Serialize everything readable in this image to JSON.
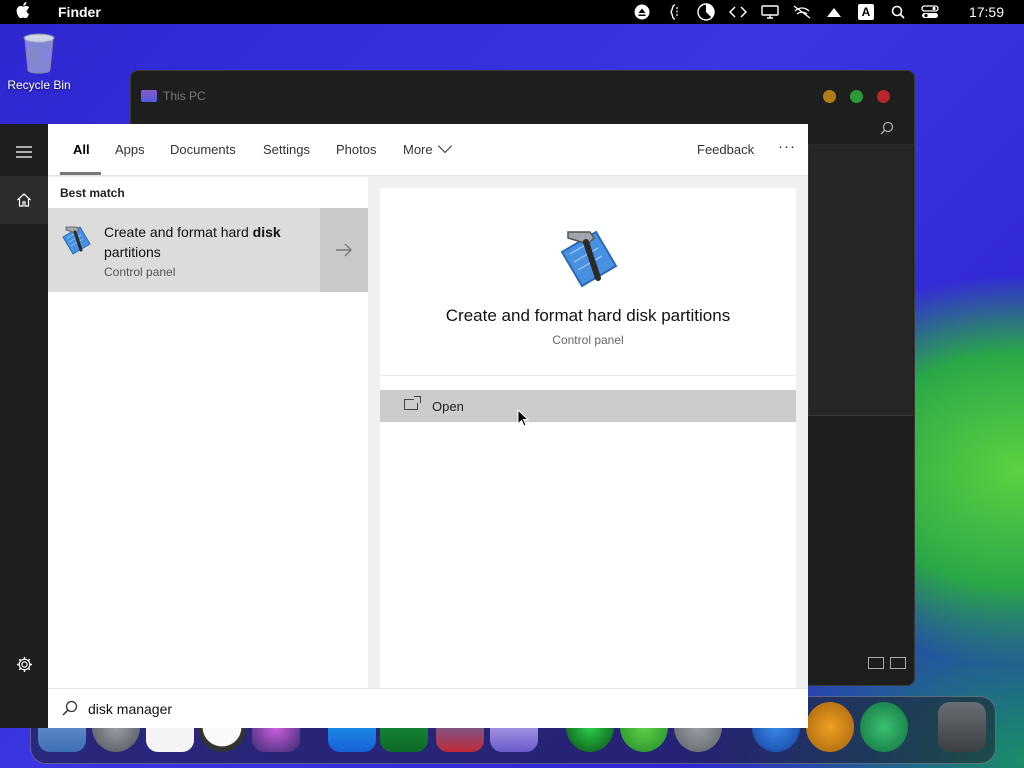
{
  "menubar": {
    "app_name": "Finder",
    "clock": "17:59",
    "status_icons": [
      "eject-icon",
      "script-icon",
      "pie-icon",
      "code-icon",
      "display-icon",
      "network-off-icon",
      "wifi-icon",
      "input-a-icon",
      "search-icon",
      "control-center-icon"
    ],
    "input_label": "A"
  },
  "desktop": {
    "recycle_bin_label": "Recycle Bin"
  },
  "background_window": {
    "title": "This PC"
  },
  "search_panel": {
    "tabs": [
      {
        "label": "All",
        "active": true
      },
      {
        "label": "Apps",
        "active": false
      },
      {
        "label": "Documents",
        "active": false
      },
      {
        "label": "Settings",
        "active": false
      },
      {
        "label": "Photos",
        "active": false
      },
      {
        "label": "More",
        "active": false
      }
    ],
    "feedback_label": "Feedback",
    "overflow_label": "···",
    "best_match_heading": "Best match",
    "best_match": {
      "title_prefix": "Create and format hard ",
      "title_highlight": "disk",
      "title_suffix": " partitions",
      "subtitle": "Control panel"
    },
    "preview": {
      "title": "Create and format hard disk partitions",
      "subtitle": "Control panel",
      "open_label": "Open"
    },
    "query": "disk manager"
  },
  "colors": {
    "rail": "#1f1f1f",
    "selected_row": "#dcdcdc",
    "action_bar": "#cccccc",
    "desktop_blue": "#3b35e2"
  }
}
